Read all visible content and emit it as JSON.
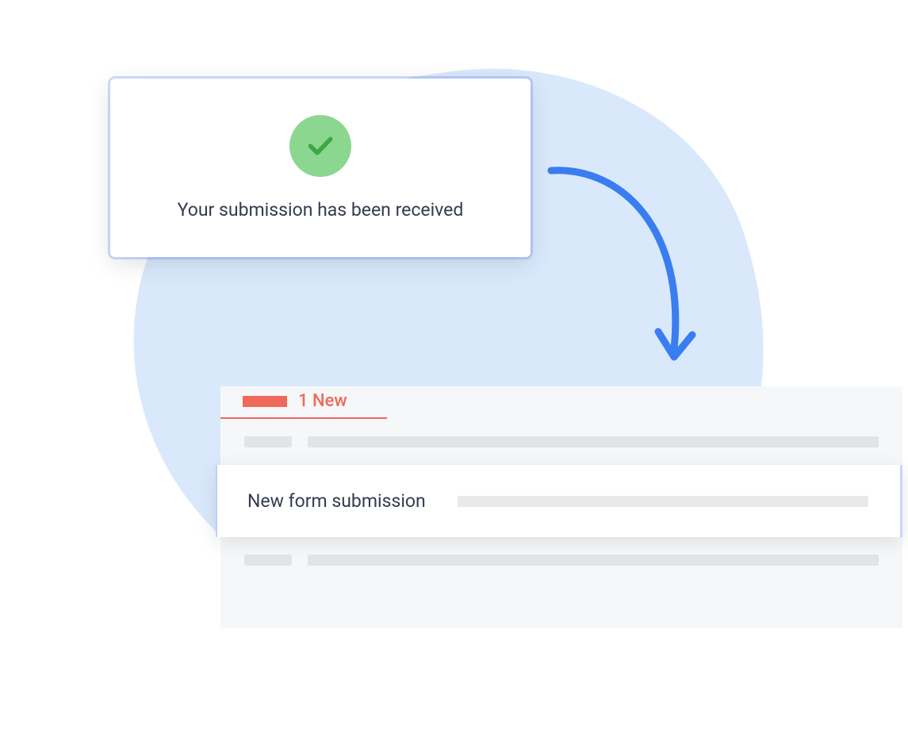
{
  "confirmation": {
    "message": "Your submission has been received",
    "icon": "checkmark-icon"
  },
  "inbox": {
    "tab": {
      "count": 1,
      "label": "1 New"
    },
    "highlighted_item": {
      "title": "New form submission"
    }
  },
  "colors": {
    "blob": "#d9e9fb",
    "accent_red": "#ef6a5a",
    "accent_blue": "#3a7df0",
    "success_green": "#8CD790",
    "success_check": "#3ba847"
  }
}
